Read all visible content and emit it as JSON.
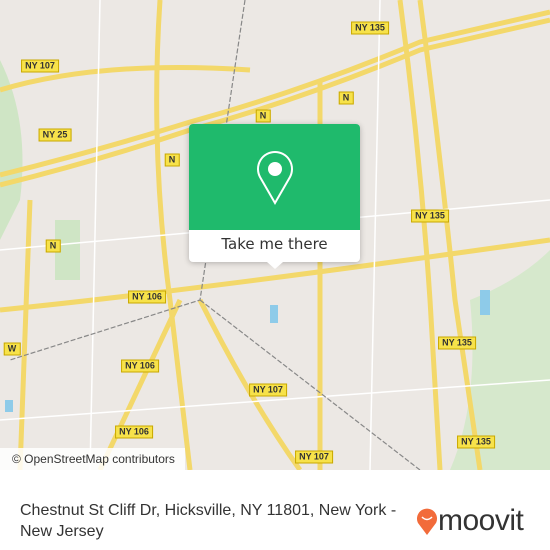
{
  "map": {
    "attribution": "© OpenStreetMap contributors",
    "road_labels": [
      "NY 135",
      "NY 107",
      "N",
      "N",
      "NY 25",
      "N",
      "NY 135",
      "N",
      "NY 106",
      "W",
      "NY 135",
      "NY 106",
      "NY 107",
      "NY 106",
      "NY 135",
      "NY 107"
    ],
    "colors": {
      "land": "#ece8e4",
      "road": "#f7e24a",
      "park": "#cfe5c5",
      "water": "#8ecbe9",
      "accent": "#1fba6c"
    }
  },
  "popup": {
    "icon": "map-pin-icon",
    "button_label": "Take me there"
  },
  "footer": {
    "address": "Chestnut St Cliff Dr, Hicksville, NY 11801, New York - New Jersey",
    "brand": "moovit",
    "brand_color": "#f26b3a"
  }
}
